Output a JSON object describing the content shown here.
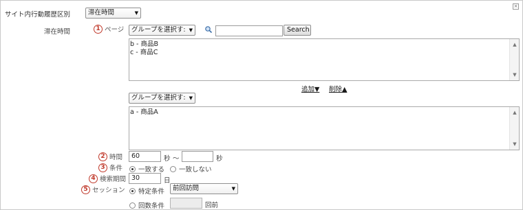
{
  "header": {
    "label": "サイト内行動履歴区別",
    "select_value": "滞在時間"
  },
  "section_label": "滞在時間",
  "page_row": {
    "number": "1",
    "label": "ページ",
    "group_select": "グループを選択す:",
    "search_button": "Search",
    "search_value": ""
  },
  "available_list": {
    "items": [
      "b - 商品B",
      "c - 商品C"
    ]
  },
  "actions": {
    "add_label": "追加▼",
    "delete_label": "削除▲"
  },
  "selected_group_select": "グループを選択す:",
  "selected_list": {
    "items": [
      "a - 商品A"
    ]
  },
  "time_row": {
    "number": "2",
    "label": "時間",
    "from_value": "60",
    "from_unit": "秒",
    "tilde": "～",
    "to_value": "",
    "to_unit": "秒"
  },
  "condition_row": {
    "number": "3",
    "label": "条件",
    "options": [
      "一致する",
      "一致しない"
    ],
    "selected": "一致する"
  },
  "period_row": {
    "number": "4",
    "label": "検索期間",
    "value": "30",
    "unit": "日"
  },
  "session_row": {
    "number": "5",
    "label": "セッション",
    "option1": "特定条件",
    "option1_select": "前回訪問",
    "option2": "回数条件",
    "option2_value": "",
    "option2_unit": "回前"
  }
}
